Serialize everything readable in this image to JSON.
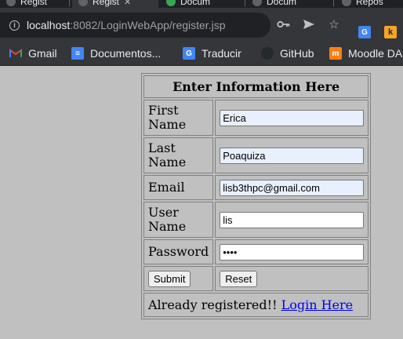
{
  "browser": {
    "tabs": [
      {
        "label": "Regist",
        "active": false
      },
      {
        "label": "Regist",
        "active": true
      },
      {
        "label": "Docum",
        "active": false
      },
      {
        "label": "Docum",
        "active": false
      },
      {
        "label": "Repos",
        "active": false
      }
    ],
    "address": {
      "host": "localhost",
      "path": ":8082/LoginWebApp/register.jsp"
    },
    "toolbar_icons": [
      "key-icon",
      "send-icon",
      "star-icon",
      "translate-extension-icon",
      "k-extension-icon"
    ],
    "bookmarks": [
      {
        "label": "Gmail",
        "icon": "gmail-icon",
        "color": "#ea4335"
      },
      {
        "label": "Documentos...",
        "icon": "docs-icon",
        "color": "#4285f4"
      },
      {
        "label": "Traducir",
        "icon": "translate-icon",
        "color": "#4285f4"
      },
      {
        "label": "GitHub",
        "icon": "github-icon",
        "color": "#24292e"
      },
      {
        "label": "Moodle DA",
        "icon": "moodle-icon",
        "color": "#f98012"
      }
    ]
  },
  "form": {
    "heading": "Enter Information Here",
    "fields": [
      {
        "label": "First Name",
        "value": "Erica",
        "autofilled": true
      },
      {
        "label": "Last Name",
        "value": "Poaquiza",
        "autofilled": true
      },
      {
        "label": "Email",
        "value": "lisb3thpc@gmail.com",
        "autofilled": true
      },
      {
        "label": "User Name",
        "value": "lis",
        "autofilled": false
      },
      {
        "label": "Password",
        "value": "••••",
        "autofilled": false
      }
    ],
    "submit_label": "Submit",
    "reset_label": "Reset",
    "footer_text": "Already registered!! ",
    "login_link": "Login Here"
  },
  "colors": {
    "page_bg": "#c0c0c0",
    "chrome_bg": "#35363a",
    "autofill_bg": "#e8f0fe",
    "link": "#0000ee"
  }
}
